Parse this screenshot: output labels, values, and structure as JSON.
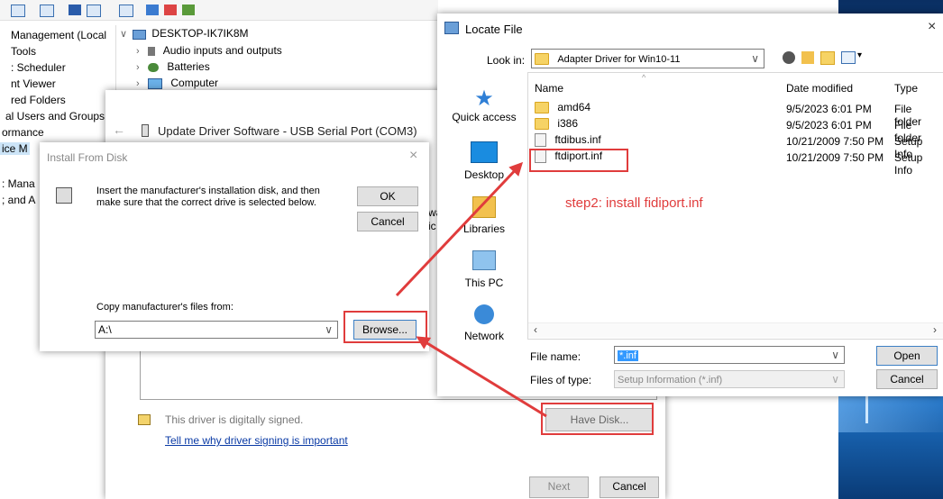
{
  "colors": {
    "accent_red": "#e03c3c",
    "selection_blue": "#3399ff",
    "button_gray": "#e1e1e1",
    "win_desktop": "#0b4a8f"
  },
  "left_panel": {
    "items": [
      "Management (Local",
      "Tools",
      ": Scheduler",
      "nt Viewer",
      "red Folders",
      "al Users and Groups",
      "ormance",
      "ice M",
      ": Mana",
      "; and A"
    ]
  },
  "tree": {
    "root": "DESKTOP-IK7IK8M",
    "children": [
      "Audio inputs and outputs",
      "Batteries",
      "Computer"
    ]
  },
  "update_driver": {
    "title": "Update Driver Software - USB Serial Port (COM3)",
    "signed_text": "This driver is digitally signed.",
    "signing_link": "Tell me why driver signing is important",
    "have_disk": "Have Disk...",
    "next": "Next",
    "cancel": "Cancel",
    "frag_wa": "wa",
    "frag_ic": "ic"
  },
  "install_from_disk": {
    "title": "Install From Disk",
    "message": "Insert the manufacturer's installation disk, and then make sure that the correct drive is selected below.",
    "ok": "OK",
    "cancel": "Cancel",
    "copy_label": "Copy manufacturer's files from:",
    "path_value": "A:\\",
    "browse": "Browse..."
  },
  "locate_file": {
    "title": "Locate File",
    "look_in_label": "Look in:",
    "look_in_value": "Adapter Driver for Win10-11",
    "places": [
      "Quick access",
      "Desktop",
      "Libraries",
      "This PC",
      "Network"
    ],
    "columns": [
      "Name",
      "Date modified",
      "Type"
    ],
    "files": [
      {
        "name": "amd64",
        "date": "9/5/2023 6:01 PM",
        "type": "File folder",
        "kind": "folder"
      },
      {
        "name": "i386",
        "date": "9/5/2023 6:01 PM",
        "type": "File folder",
        "kind": "folder"
      },
      {
        "name": "ftdibus.inf",
        "date": "10/21/2009 7:50 PM",
        "type": "Setup Info",
        "kind": "file"
      },
      {
        "name": "ftdiport.inf",
        "date": "10/21/2009 7:50 PM",
        "type": "Setup Info",
        "kind": "file"
      }
    ],
    "file_name_label": "File name:",
    "file_name_value": "*.inf",
    "files_of_type_label": "Files of type:",
    "files_of_type_value": "Setup Information (*.inf)",
    "open": "Open",
    "cancel": "Cancel"
  },
  "annotation": {
    "step2": "step2: install fidiport.inf"
  }
}
